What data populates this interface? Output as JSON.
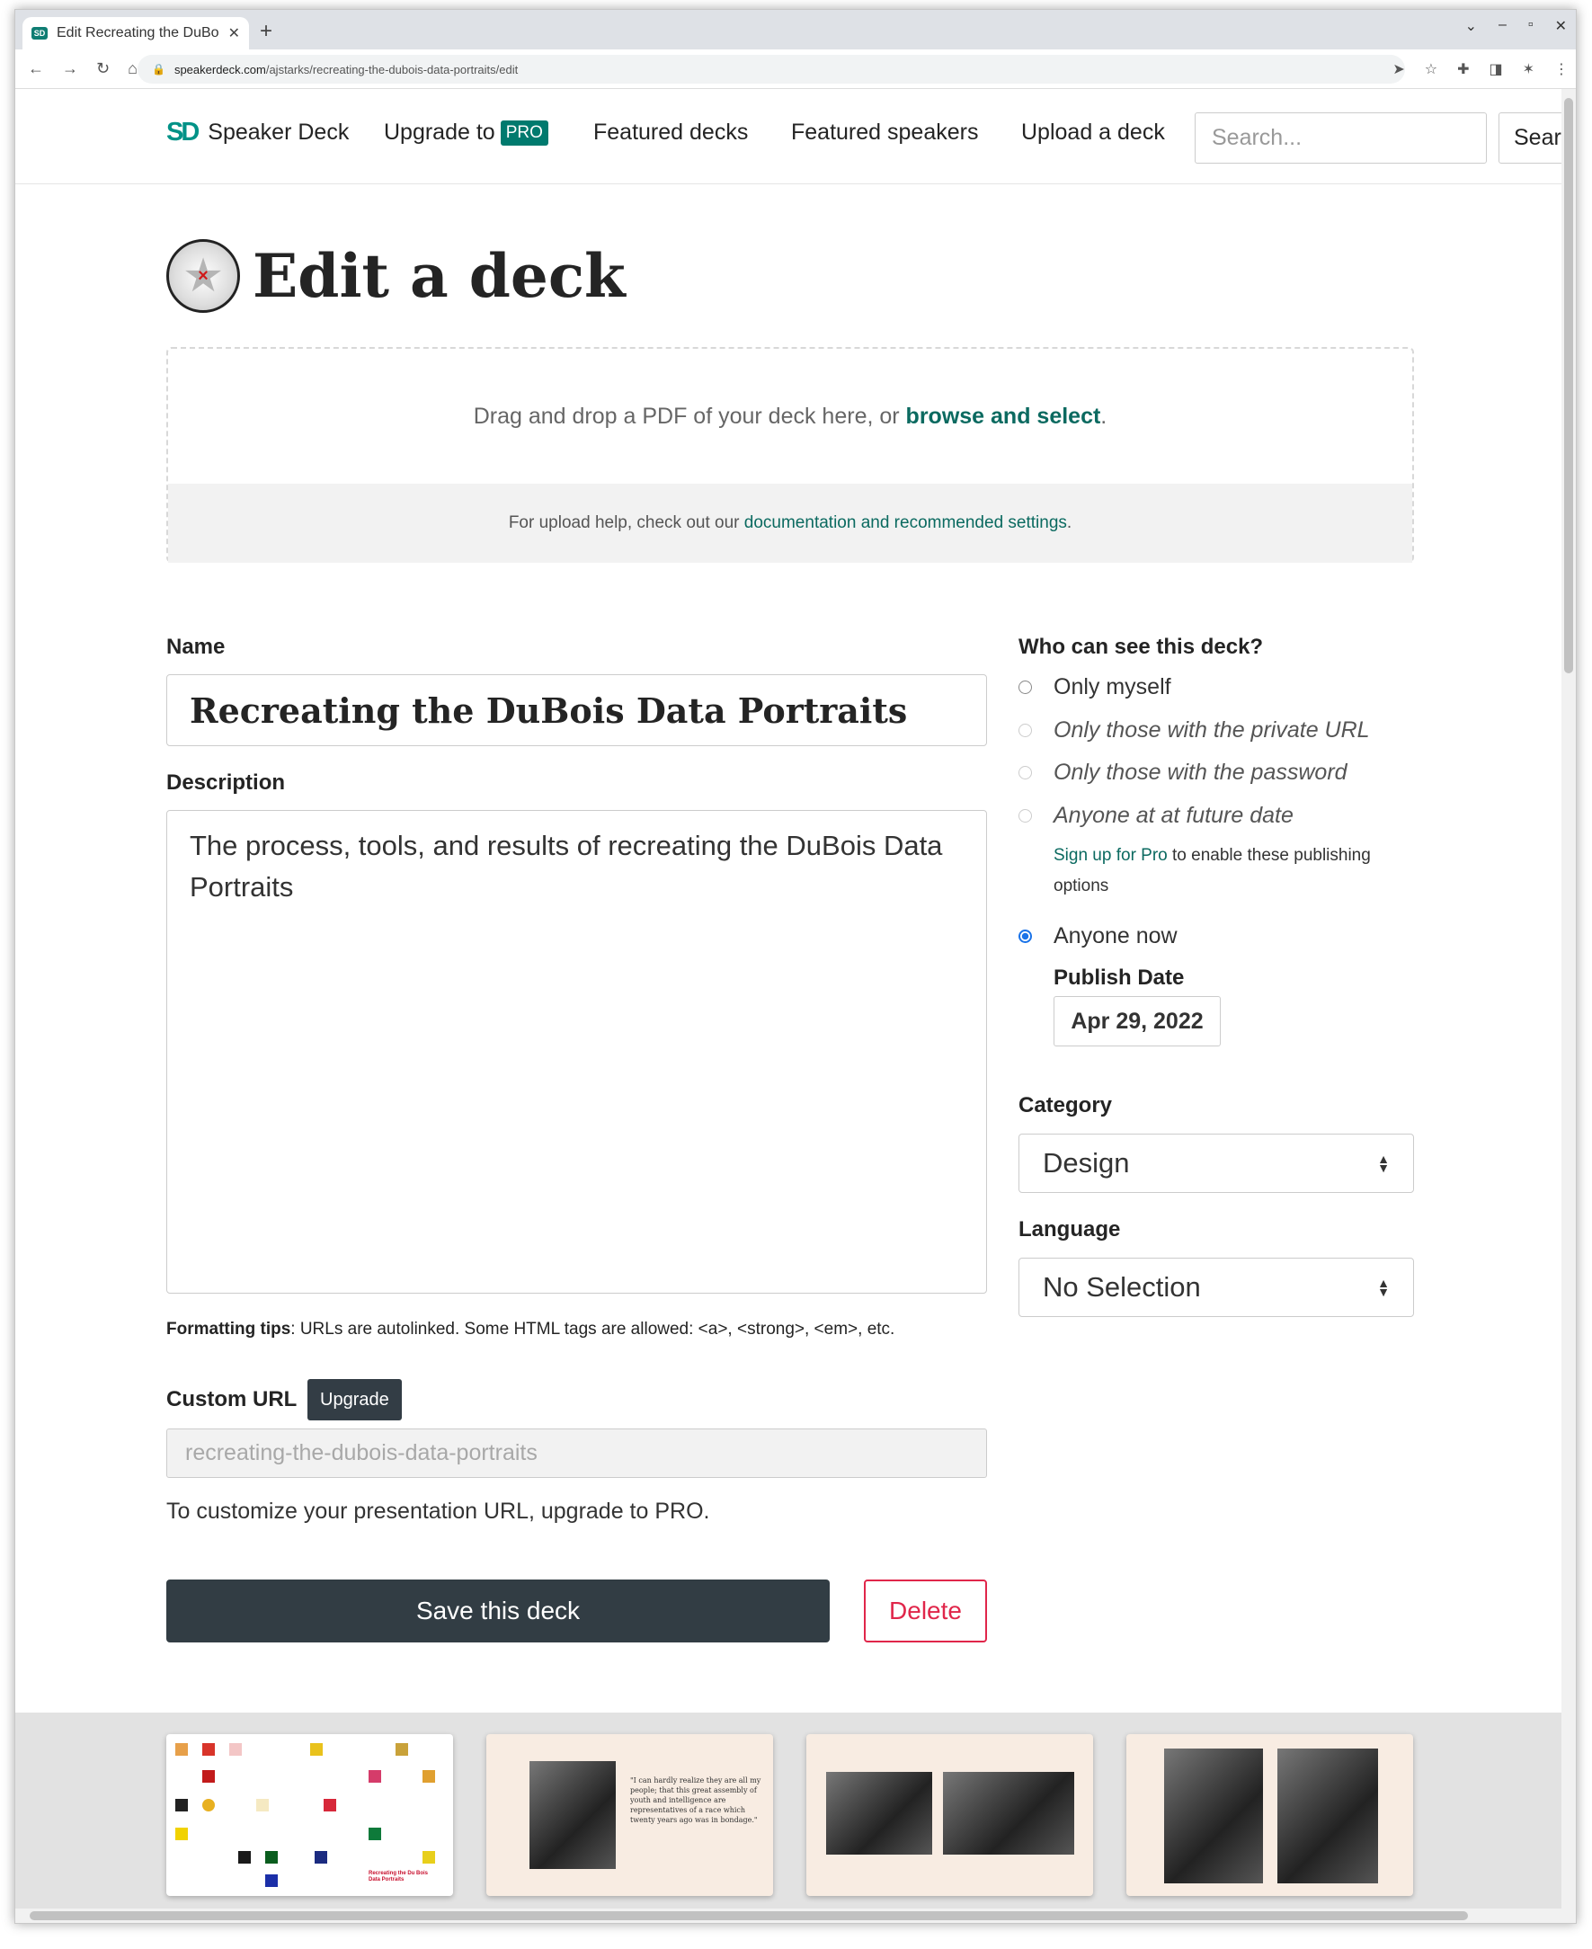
{
  "browser": {
    "tab_title": "Edit Recreating the DuBo",
    "tab_close": "✕",
    "new_tab": "+",
    "url_host": "speakerdeck.com",
    "url_path": "/ajstarks/recreating-the-dubois-data-portraits/edit"
  },
  "header": {
    "brand": "Speaker Deck",
    "upgrade_label": "Upgrade to",
    "pro_badge": "PRO",
    "featured_decks": "Featured decks",
    "featured_speakers": "Featured speakers",
    "upload": "Upload a deck",
    "search_placeholder": "Search...",
    "search_button": "Search"
  },
  "page": {
    "title": "Edit a deck"
  },
  "dropzone": {
    "text": "Drag and drop a PDF of your deck here, or ",
    "link": "browse and select",
    "period": ".",
    "help_text": "For upload help, check out our ",
    "help_link": "documentation and recommended settings",
    "help_period": "."
  },
  "form": {
    "name_label": "Name",
    "name_value": "Recreating the DuBois Data Portraits",
    "description_label": "Description",
    "description_value": "The process, tools, and results of recreating the DuBois Data Portraits",
    "formatting_bold": "Formatting tips",
    "formatting_text": ": URLs are autolinked. Some HTML tags are allowed: <a>, <strong>, <em>, etc.",
    "custom_url_label": "Custom URL",
    "upgrade_badge": "Upgrade",
    "custom_url_value": "recreating-the-dubois-data-portraits",
    "custom_url_hint": "To customize your presentation URL, upgrade to PRO.",
    "save_button": "Save this deck",
    "delete_button": "Delete"
  },
  "visibility": {
    "label": "Who can see this deck?",
    "options": [
      {
        "label": "Only myself"
      },
      {
        "label": "Only those with the private URL"
      },
      {
        "label": "Only those with the password"
      },
      {
        "label": "Anyone at at future date"
      },
      {
        "label": "Anyone now"
      }
    ],
    "pro_link": "Sign up for Pro",
    "pro_text": " to enable these publishing options",
    "publish_date_label": "Publish Date",
    "publish_date_value": "Apr 29, 2022"
  },
  "category": {
    "label": "Category",
    "value": "Design"
  },
  "language": {
    "label": "Language",
    "value": "No Selection"
  },
  "thumbnails": {
    "slide1_caption": "Recreating the Du Bois Data Portraits",
    "slide2_quote": "\"I can hardly realize they are all my people; that this great assembly of youth and intelligence are representatives of a race which twenty years ago was in bondage.\""
  },
  "colors": {
    "accent": "#0b6a60",
    "dark_button": "#323d44",
    "danger": "#e0264a"
  }
}
